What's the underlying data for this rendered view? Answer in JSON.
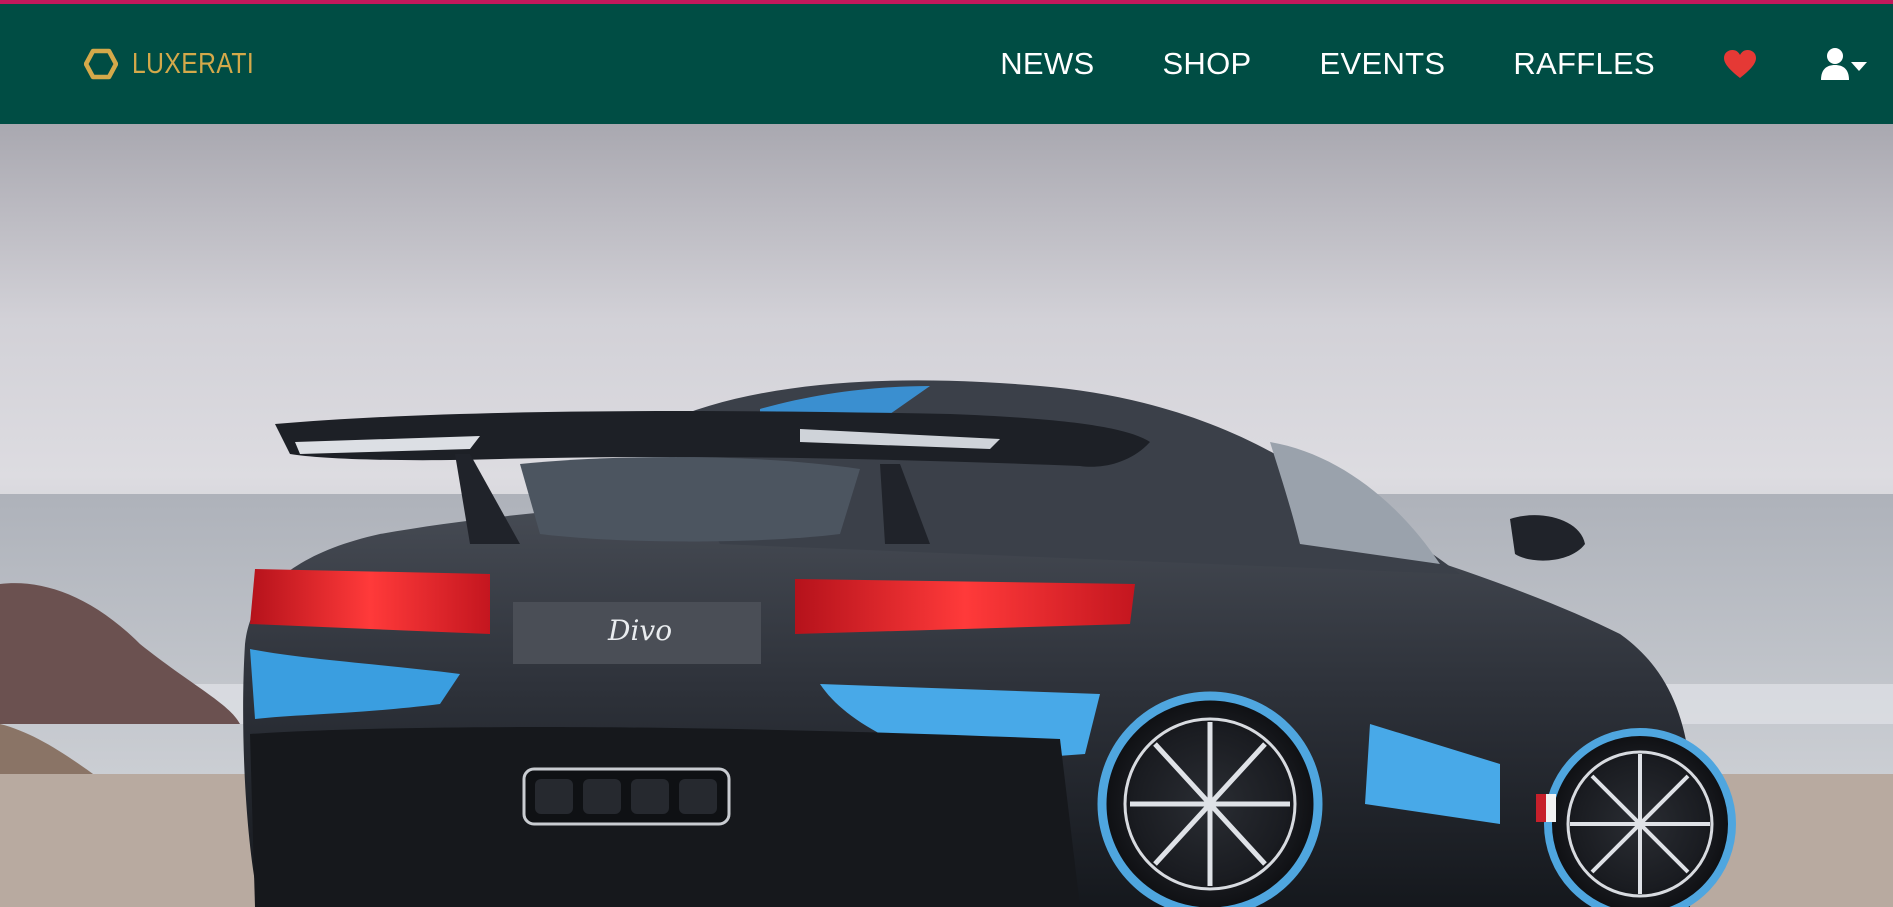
{
  "brand": {
    "name": "LUXERATI",
    "logo_icon": "hexagon-icon",
    "color": "#d4a94a"
  },
  "nav": {
    "background": "#004d44",
    "accent_bar": "#c2185b",
    "links": [
      {
        "label": "NEWS"
      },
      {
        "label": "SHOP"
      },
      {
        "label": "EVENTS"
      },
      {
        "label": "RAFFLES"
      }
    ],
    "favorites_icon": "heart-icon",
    "favorites_color": "#e53935",
    "account_icon": "user-dropdown-icon"
  },
  "hero": {
    "image_subject": "car-rear-view",
    "badge_text": "Divo"
  }
}
